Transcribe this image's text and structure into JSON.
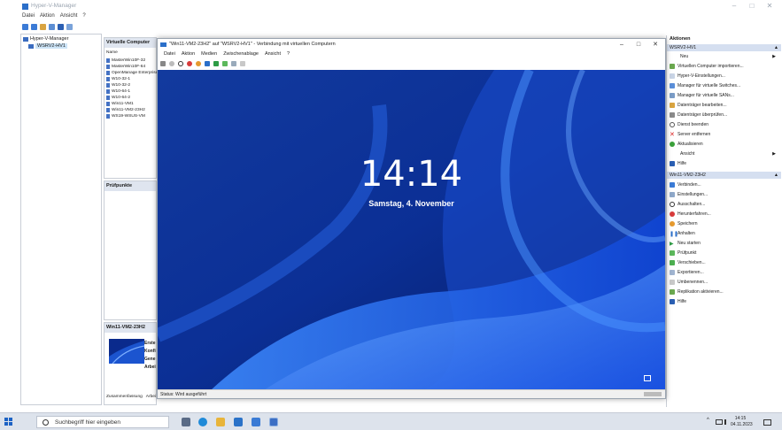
{
  "manager": {
    "title": "Hyper-V-Manager",
    "menu": [
      "Datei",
      "Aktion",
      "Ansicht",
      "?"
    ]
  },
  "tree": {
    "root": "Hyper-V-Manager",
    "server": "WSRV2-HV1"
  },
  "vm_panel": {
    "header": "Virtuelle Computer",
    "column": "Name",
    "vms": [
      "MasterWin10F-32",
      "MasterWin10F-64",
      "OpenManage Enterprise",
      "W10-32-1",
      "W10-32-2",
      "W10-64-1",
      "W10-64-2",
      "Win11-VM1",
      "Win11-VM2-23H2",
      "WS19-WSUS-VM"
    ]
  },
  "checkpoints": {
    "header": "Prüfpunkte"
  },
  "summary": {
    "header": "Win11-VM2-23H2",
    "labels": [
      "Erste",
      "Konfi",
      "Gene",
      "Arbei"
    ],
    "tabs": [
      "Zusammenfassung",
      "Arbei"
    ]
  },
  "vm_connection": {
    "title": "\"Win11-VM2-23H2\" auf \"WSRV2-HV1\" - Verbindung mit virtuellen Computern",
    "menu": [
      "Datei",
      "Aktion",
      "Medien",
      "Zwischenablage",
      "Ansicht",
      "?"
    ],
    "lock_time": "14:14",
    "lock_date": "Samstag, 4. November",
    "status": "Status: Wird ausgeführt"
  },
  "actions": {
    "header": "Aktionen",
    "server_section": "WSRV2-HV1",
    "server_items": [
      "Neu",
      "Virtuellen Computer importieren...",
      "Hyper-V-Einstellungen...",
      "Manager für virtuelle Switches...",
      "Manager für virtuelle SANs...",
      "Datenträger bearbeiten...",
      "Datenträger überprüfen...",
      "Dienst beenden",
      "Server entfernen",
      "Aktualisieren",
      "Ansicht",
      "Hilfe"
    ],
    "vm_section": "Win11-VM2-23H2",
    "vm_items": [
      "Verbinden...",
      "Einstellungen...",
      "Ausschalten...",
      "Herunterfahren...",
      "Speichern",
      "Anhalten",
      "Neu starten",
      "Prüfpunkt",
      "Verschieben...",
      "Exportieren...",
      "Umbenennen...",
      "Replikation aktivieren...",
      "Hilfe"
    ]
  },
  "taskbar": {
    "search_placeholder": "Suchbegriff hier eingeben",
    "time": "14:15",
    "date": "04.11.2023"
  }
}
